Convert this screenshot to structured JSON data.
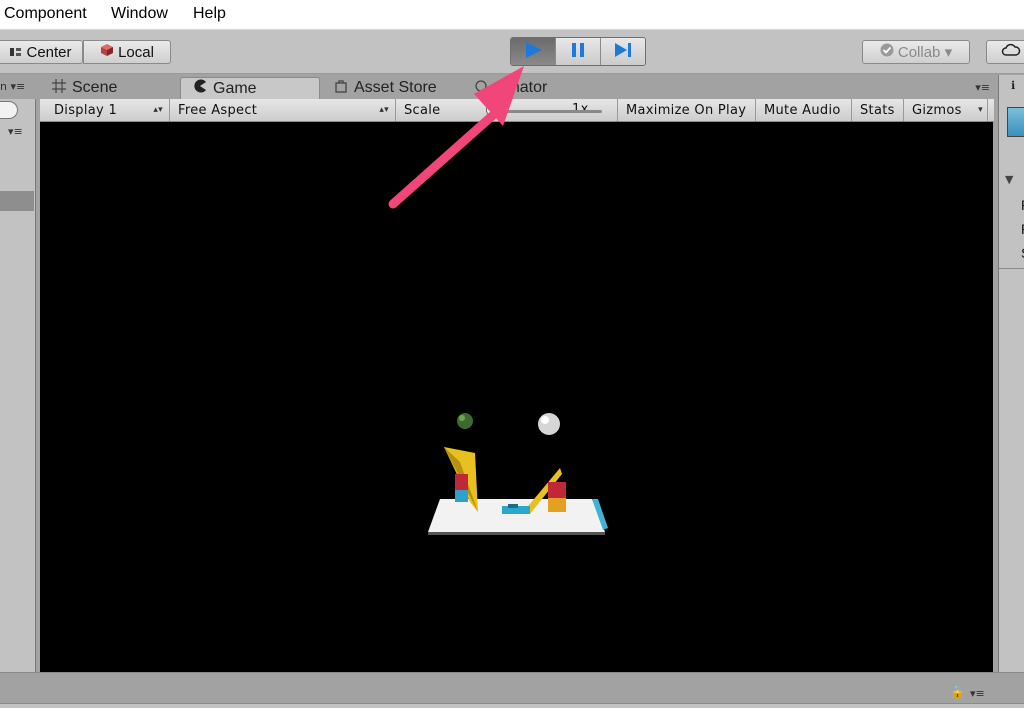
{
  "menubar": {
    "items": [
      "Component",
      "Window",
      "Help"
    ]
  },
  "toolbar": {
    "pivot_label": "Center",
    "rotation_label": "Local",
    "collab_label": "Collab ▾"
  },
  "tabs": [
    {
      "label": "Scene",
      "icon": "grid-icon"
    },
    {
      "label": "Game",
      "icon": "pacman-icon",
      "active": true
    },
    {
      "label": "Asset Store",
      "icon": "bag-icon"
    },
    {
      "label": "nimator",
      "icon": "animator-icon"
    }
  ],
  "game_toolbar": {
    "display": "Display 1",
    "aspect": "Free Aspect",
    "scale_label": "Scale",
    "scale_value": "1x",
    "maximize": "Maximize On Play",
    "mute": "Mute Audio",
    "stats": "Stats",
    "gizmos": "Gizmos"
  },
  "right_panel": {
    "letters": [
      "P",
      "P",
      "S"
    ]
  },
  "colors": {
    "annotation_arrow": "#f0467a",
    "play_accent": "#1e7ad8",
    "viewport_bg": "#000000"
  }
}
